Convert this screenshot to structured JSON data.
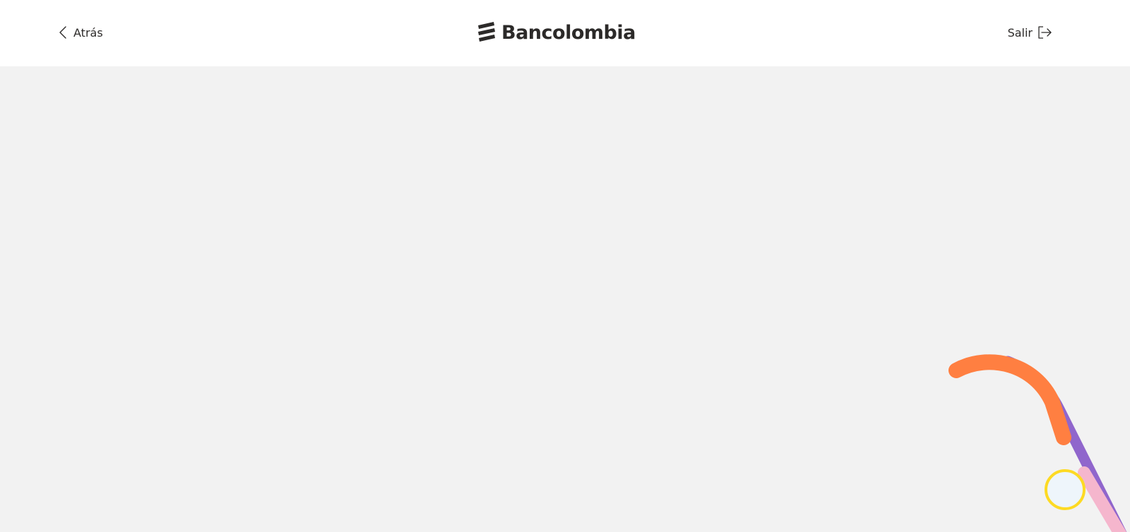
{
  "header": {
    "back_label": "Atrás",
    "logo_text": "Bancolombia",
    "exit_label": "Salir"
  },
  "icons": {
    "back": "chevron-left-icon",
    "exit": "logout-icon",
    "logo_mark": "bancolombia-logo-mark"
  },
  "colors": {
    "header_bg": "#ffffff",
    "page_bg": "#f2f2f2",
    "text": "#2c2a29",
    "accent_orange": "#ff7f41",
    "accent_purple": "#9066cc",
    "accent_pink": "#f5b6cd",
    "accent_yellow": "#fdda24"
  }
}
